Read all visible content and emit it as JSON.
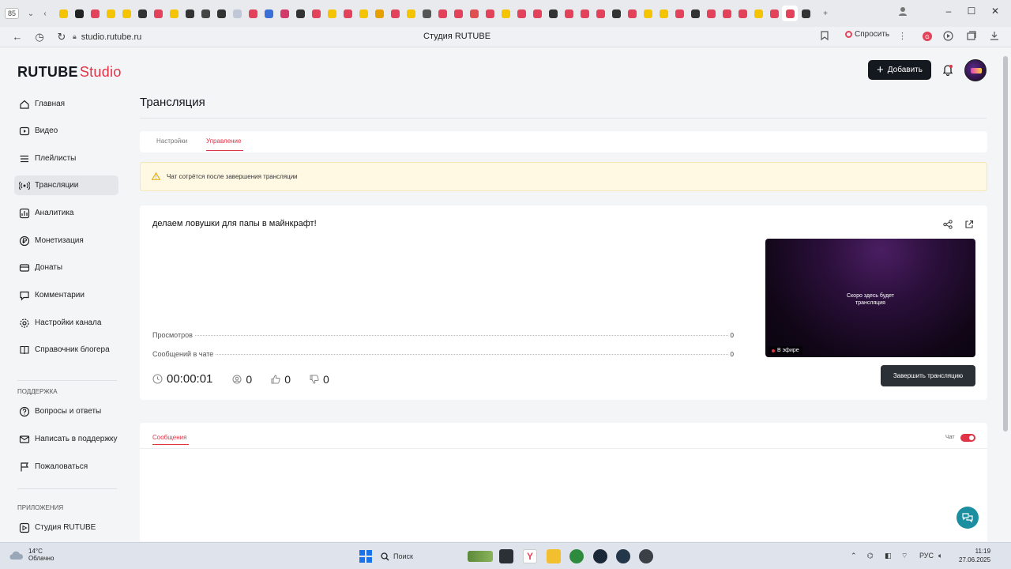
{
  "browser": {
    "tab_count": "85",
    "tab_icon_colors": [
      "#f5c400",
      "#222222",
      "#e2435a",
      "#f5c400",
      "#f5c400",
      "#333333",
      "#e2435a",
      "#f5c400",
      "#333333",
      "#444444",
      "#333333",
      "#c0c8d8",
      "#e2435a",
      "#3a6fd8",
      "#d23a6a",
      "#333333",
      "#e2435a",
      "#f5c400",
      "#e2435a",
      "#f5c400",
      "#e8a000",
      "#e2435a",
      "#f5c400",
      "#555555",
      "#e2435a",
      "#e2435a",
      "#e05050",
      "#e2435a",
      "#f5c400",
      "#e2435a",
      "#e2435a",
      "#333333",
      "#e2435a",
      "#e2435a",
      "#e2435a",
      "#333333",
      "#e2435a",
      "#f5c400",
      "#f5c400",
      "#e2435a",
      "#333333",
      "#e2435a",
      "#e2435a",
      "#e2435a",
      "#f5c400",
      "#e2435a",
      "#e2435a",
      "#333333"
    ],
    "url": "studio.rutube.ru",
    "page_title": "Студия RUTUBE",
    "ask_label": "Спросить"
  },
  "header": {
    "logo_main": "RUTUBE",
    "logo_accent": "Studio",
    "add_label": "Добавить"
  },
  "sidebar": {
    "items": [
      {
        "label": "Главная",
        "icon": "home-icon"
      },
      {
        "label": "Видео",
        "icon": "video-icon"
      },
      {
        "label": "Плейлисты",
        "icon": "playlist-icon"
      },
      {
        "label": "Трансляции",
        "icon": "broadcast-icon",
        "active": true
      },
      {
        "label": "Аналитика",
        "icon": "analytics-icon"
      },
      {
        "label": "Монетизация",
        "icon": "ruble-icon"
      },
      {
        "label": "Донаты",
        "icon": "donate-icon"
      },
      {
        "label": "Комментарии",
        "icon": "comment-icon"
      },
      {
        "label": "Настройки канала",
        "icon": "gear-icon"
      },
      {
        "label": "Справочник блогера",
        "icon": "book-icon"
      }
    ],
    "support_title": "ПОДДЕРЖКА",
    "support_items": [
      {
        "label": "Вопросы и ответы",
        "icon": "help-icon"
      },
      {
        "label": "Написать в поддержку",
        "icon": "mail-icon"
      },
      {
        "label": "Пожаловаться",
        "icon": "flag-icon"
      }
    ],
    "apps_title": "ПРИЛОЖЕНИЯ",
    "apps_items": [
      {
        "label": "Студия RUTUBE",
        "icon": "studio-app-icon"
      }
    ]
  },
  "main": {
    "title": "Трансляция",
    "tabs": [
      {
        "label": "Настройки"
      },
      {
        "label": "Управление",
        "active": true
      }
    ],
    "warning": "Чат сотрётся после завершения трансляции",
    "stream_title": "делаем ловушки для папы в майнкрафт!",
    "stats": [
      {
        "label": "Просмотров",
        "value": "0"
      },
      {
        "label": "Сообщений в чате",
        "value": "0"
      }
    ],
    "preview_text_1": "Скоро здесь будет",
    "preview_text_2": "трансляция",
    "live_label": "В эфире",
    "duration": "00:00:01",
    "viewers": "0",
    "likes": "0",
    "dislikes": "0",
    "end_label": "Завершить трансляцию",
    "chat_tab": "Сообщения",
    "chat_toggle_label": "Чат",
    "chat_enabled": true
  },
  "taskbar": {
    "temperature": "14°C",
    "weather": "Облачно",
    "search_placeholder": "Поиск",
    "language": "РУС",
    "time": "11:19",
    "date": "27.06.2025"
  },
  "colors": {
    "accent": "#e03345",
    "dark_button": "#14181f",
    "warning_bg": "#fff8e3",
    "help_fab": "#1b8fa0"
  }
}
